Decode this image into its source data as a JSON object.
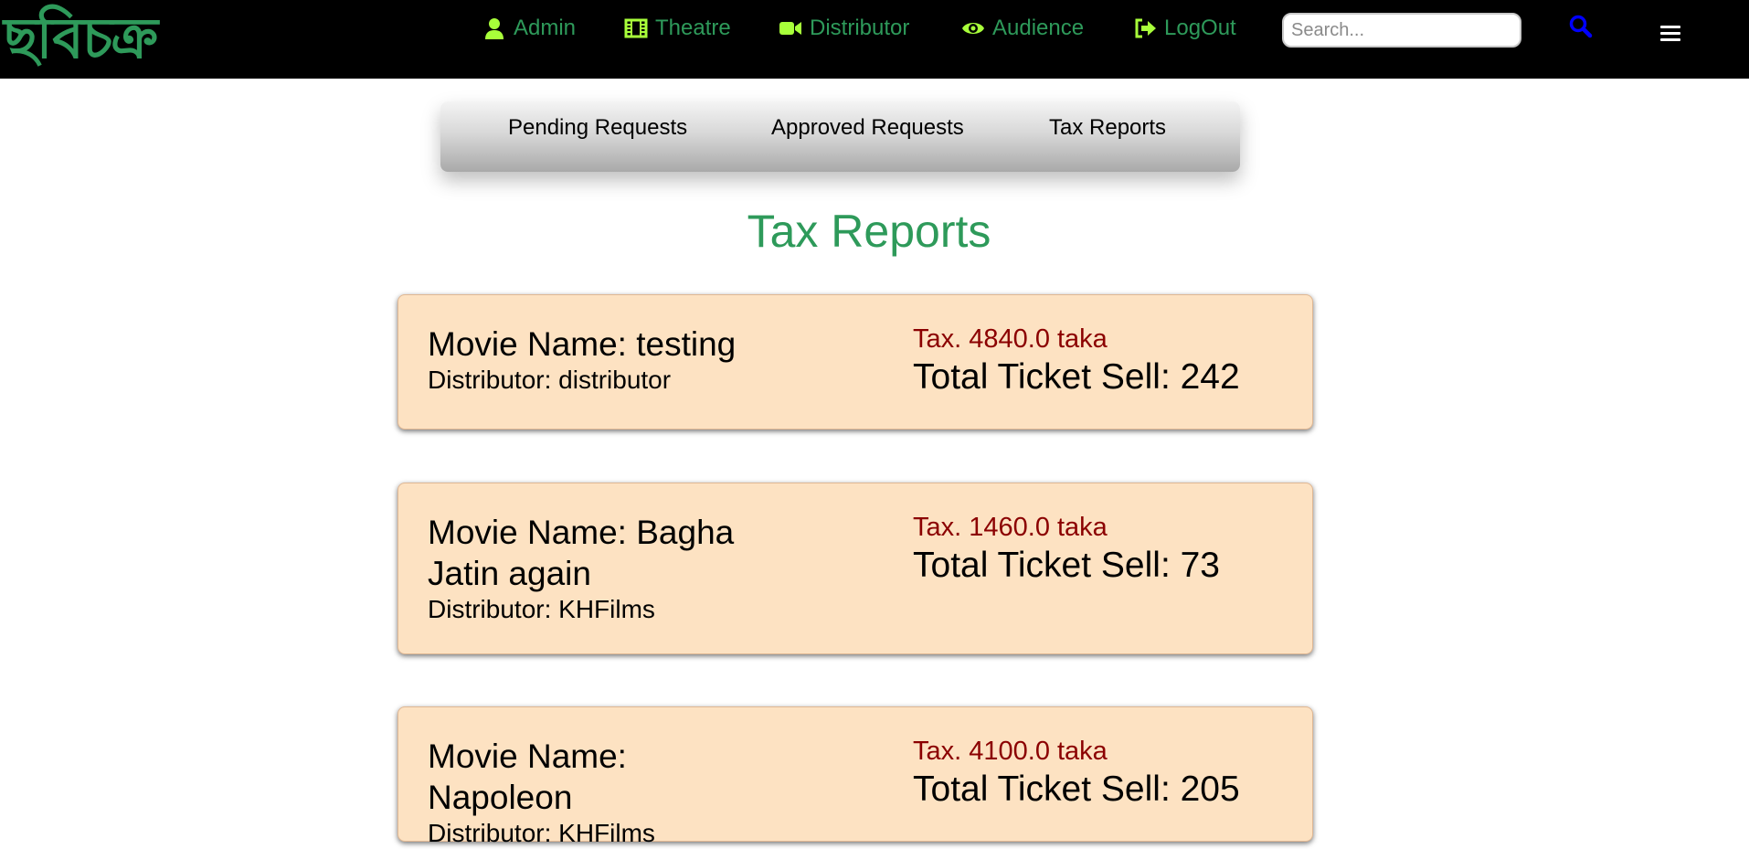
{
  "header": {
    "logo": "ছবিচক্র",
    "nav": [
      {
        "label": "Admin",
        "icon": "user-icon"
      },
      {
        "label": "Theatre",
        "icon": "film-icon"
      },
      {
        "label": "Distributor",
        "icon": "video-camera-icon"
      },
      {
        "label": "Audience",
        "icon": "eye-icon"
      },
      {
        "label": "LogOut",
        "icon": "logout-icon"
      }
    ],
    "search_placeholder": "Search...",
    "search_icon": "search-icon",
    "menu_icon": "hamburger-menu-icon"
  },
  "subnav": {
    "items": [
      "Pending Requests",
      "Approved Requests",
      "Tax Reports"
    ]
  },
  "page": {
    "title": "Tax Reports"
  },
  "reports": [
    {
      "movie": "Movie Name: testing",
      "distributor": "Distributor: distributor",
      "tax": "Tax. 4840.0 taka",
      "tickets": "Total Ticket Sell: 242"
    },
    {
      "movie": "Movie Name: Bagha Jatin again",
      "distributor": "Distributor: KHFilms",
      "tax": "Tax. 1460.0 taka",
      "tickets": "Total Ticket Sell: 73"
    },
    {
      "movie": "Movie Name: Napoleon",
      "distributor": "Distributor: KHFilms",
      "tax": "Tax. 4100.0 taka",
      "tickets": "Total Ticket Sell: 205"
    }
  ],
  "colors": {
    "brand_green": "#2e9a5a",
    "icon_green": "#a8ff3a",
    "card_background": "#fde2c2",
    "tax_red": "#8b0000",
    "search_blue": "#0000ff"
  }
}
